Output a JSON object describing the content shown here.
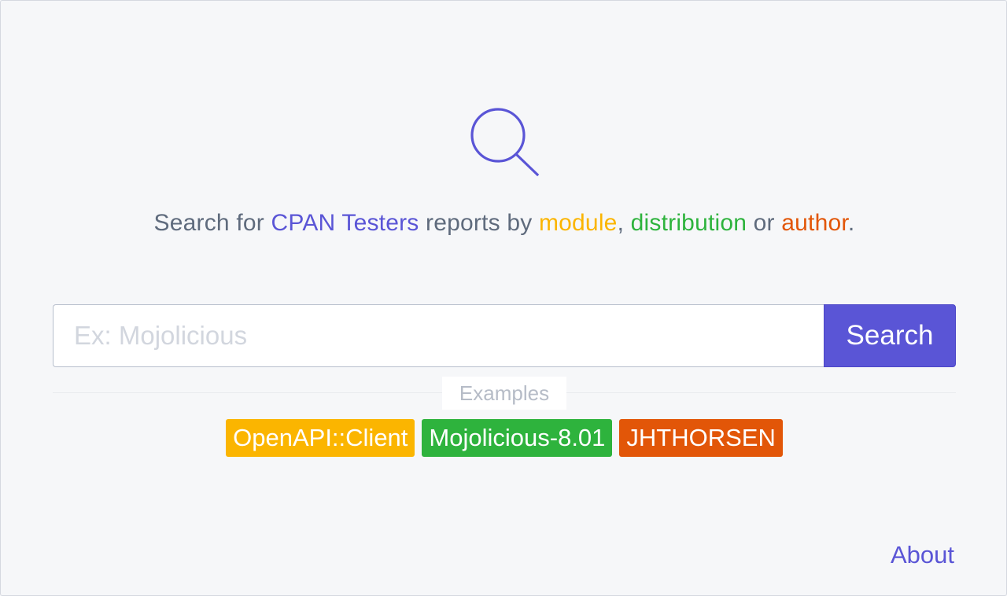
{
  "logo": {
    "icon": "magnifier-icon",
    "color": "#5a55d6"
  },
  "tagline": {
    "prefix": "Search for ",
    "cpan_testers": "CPAN Testers",
    "mid": " reports by ",
    "module": "module",
    "comma": ", ",
    "distribution": "distribution",
    "or": " or ",
    "author": "author",
    "period": "."
  },
  "search": {
    "value": "",
    "placeholder": "Ex: Mojolicious",
    "button_label": "Search"
  },
  "examples": {
    "label": "Examples",
    "items": [
      {
        "label": "OpenAPI::Client",
        "kind": "module",
        "color": "#fbb500"
      },
      {
        "label": "Mojolicious-8.01",
        "kind": "distribution",
        "color": "#2eb33d"
      },
      {
        "label": "JHTHORSEN",
        "kind": "author",
        "color": "#e25608"
      }
    ]
  },
  "footer": {
    "about_label": "About"
  },
  "colors": {
    "accent": "#5a55d6",
    "module": "#fbb500",
    "distribution": "#2eb33d",
    "author": "#e25608",
    "background": "#f6f7f9"
  }
}
